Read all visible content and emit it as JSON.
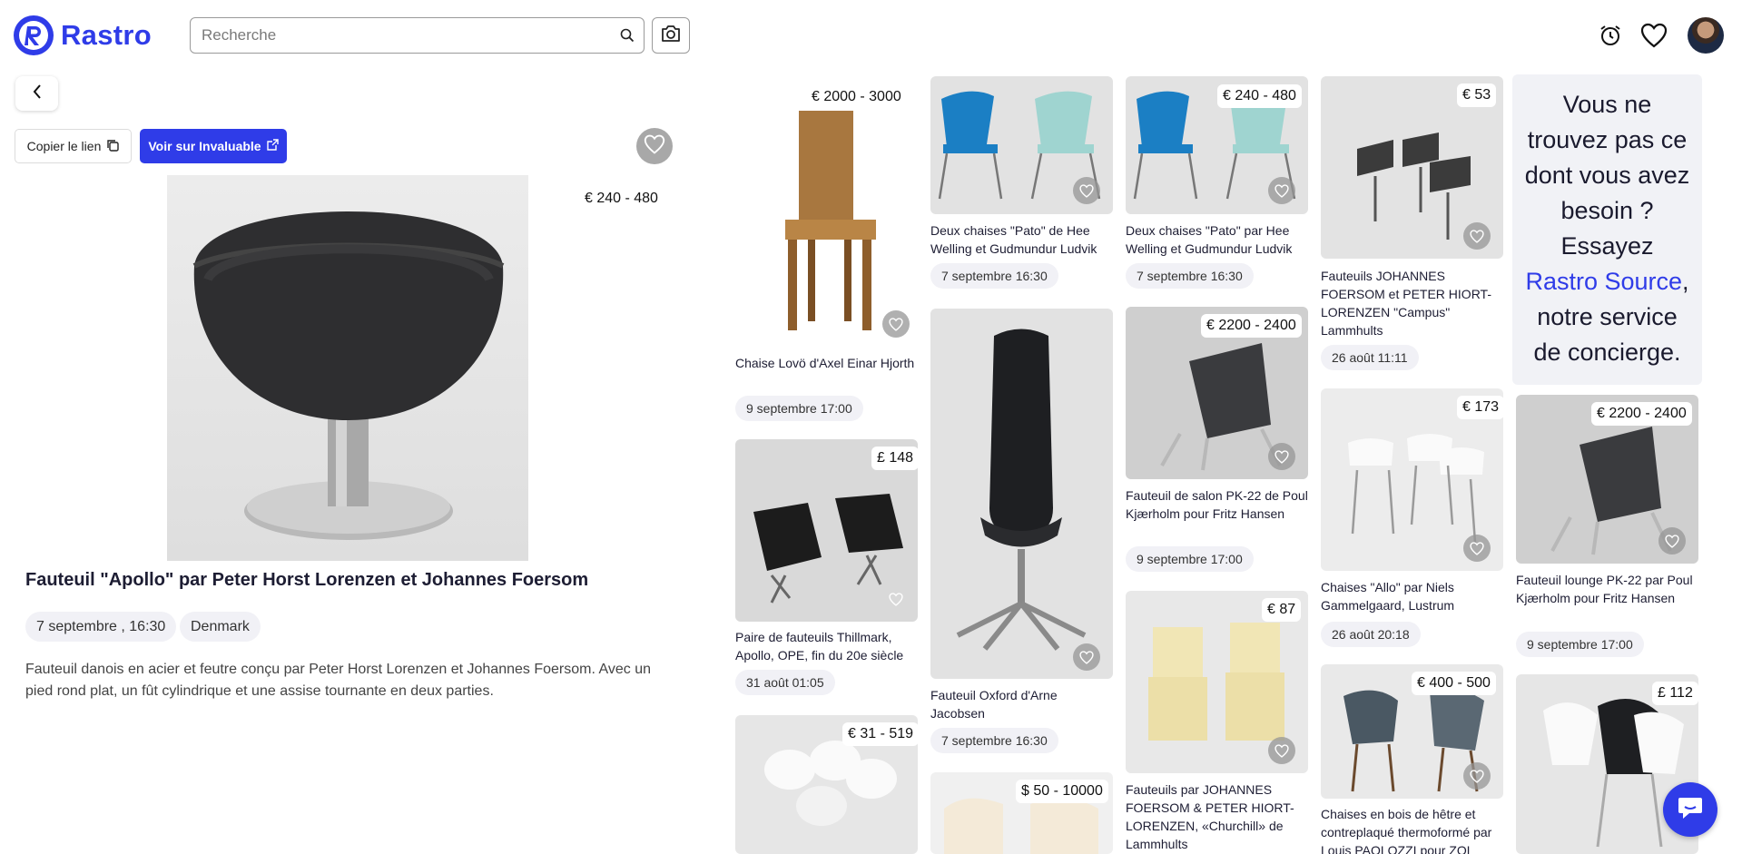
{
  "brand": {
    "name": "Rastro",
    "color": "#2f3ce8"
  },
  "search": {
    "placeholder": "Recherche"
  },
  "header_icons": [
    "search-icon",
    "camera-icon",
    "alarm-clock-icon",
    "heart-icon",
    "avatar"
  ],
  "detail": {
    "copy_label": "Copier le lien",
    "invaluable_label": "Voir sur Invaluable",
    "price": "€ 240 - 480",
    "title": "Fauteuil \"Apollo\" par Peter Horst Lorenzen et Johannes Foersom",
    "date": "7 septembre , 16:30",
    "location": "Denmark",
    "description": "Fauteuil danois en acier et feutre conçu par Peter Horst Lorenzen et Johannes Foersom. Avec un pied rond plat, un fût cylindrique et une assise tournante en deux parties."
  },
  "cards": [
    {
      "price": "€ 2000 - 3000",
      "title": "Chaise Lovö d'Axel Einar Hjorth",
      "date": "9 septembre 17:00"
    },
    {
      "price": "£ 148",
      "title": "Paire de fauteuils Thillmark, Apollo, OPE, fin du 20e siècle",
      "date": "31 août 01:05"
    },
    {
      "price": "€ 31 - 519",
      "title": "",
      "date": ""
    },
    {
      "price": "",
      "title": "Deux chaises \"Pato\" de Hee Welling et Gudmundur Ludvik",
      "date": "7 septembre 16:30"
    },
    {
      "price": "",
      "title": "Fauteuil Oxford d'Arne Jacobsen",
      "date": "7 septembre 16:30"
    },
    {
      "price": "$ 50 - 10000",
      "title": "",
      "date": ""
    },
    {
      "price": "€ 240 - 480",
      "title": "Deux chaises \"Pato\" par Hee Welling et Gudmundur Ludvik",
      "date": "7 septembre 16:30"
    },
    {
      "price": "€ 2200 - 2400",
      "title": "Fauteuil de salon PK-22 de Poul Kjærholm pour Fritz Hansen",
      "date": "9 septembre 17:00"
    },
    {
      "price": "€ 87",
      "title": "Fauteuils par JOHANNES FOERSOM & PETER HIORT-LORENZEN, «Churchill» de Lammhults",
      "date": ""
    },
    {
      "price": "€ 53",
      "title": "Fauteuils JOHANNES FOERSOM et PETER HIORT-LORENZEN \"Campus\" Lammhults",
      "date": "26 août 11:11"
    },
    {
      "price": "€ 173",
      "title": "Chaises \"Allo\" par Niels Gammelgaard, Lustrum",
      "date": "26 août 20:18"
    },
    {
      "price": "€ 400 - 500",
      "title": "Chaises en bois de hêtre et contreplaqué thermoformé par Louis PAOLOZZI pour ZOL",
      "date": ""
    },
    {
      "price": "€ 2200 - 2400",
      "title": "Fauteuil lounge PK-22 par Poul Kjærholm pour Fritz Hansen",
      "date": "9 septembre 17:00"
    },
    {
      "price": "£ 112",
      "title": "",
      "date": ""
    }
  ],
  "promo": {
    "text_before": "Vous ne trouvez pas ce dont vous avez besoin ? Essayez ",
    "highlight": "Rastro Source",
    "text_after": ", notre service de concierge."
  }
}
